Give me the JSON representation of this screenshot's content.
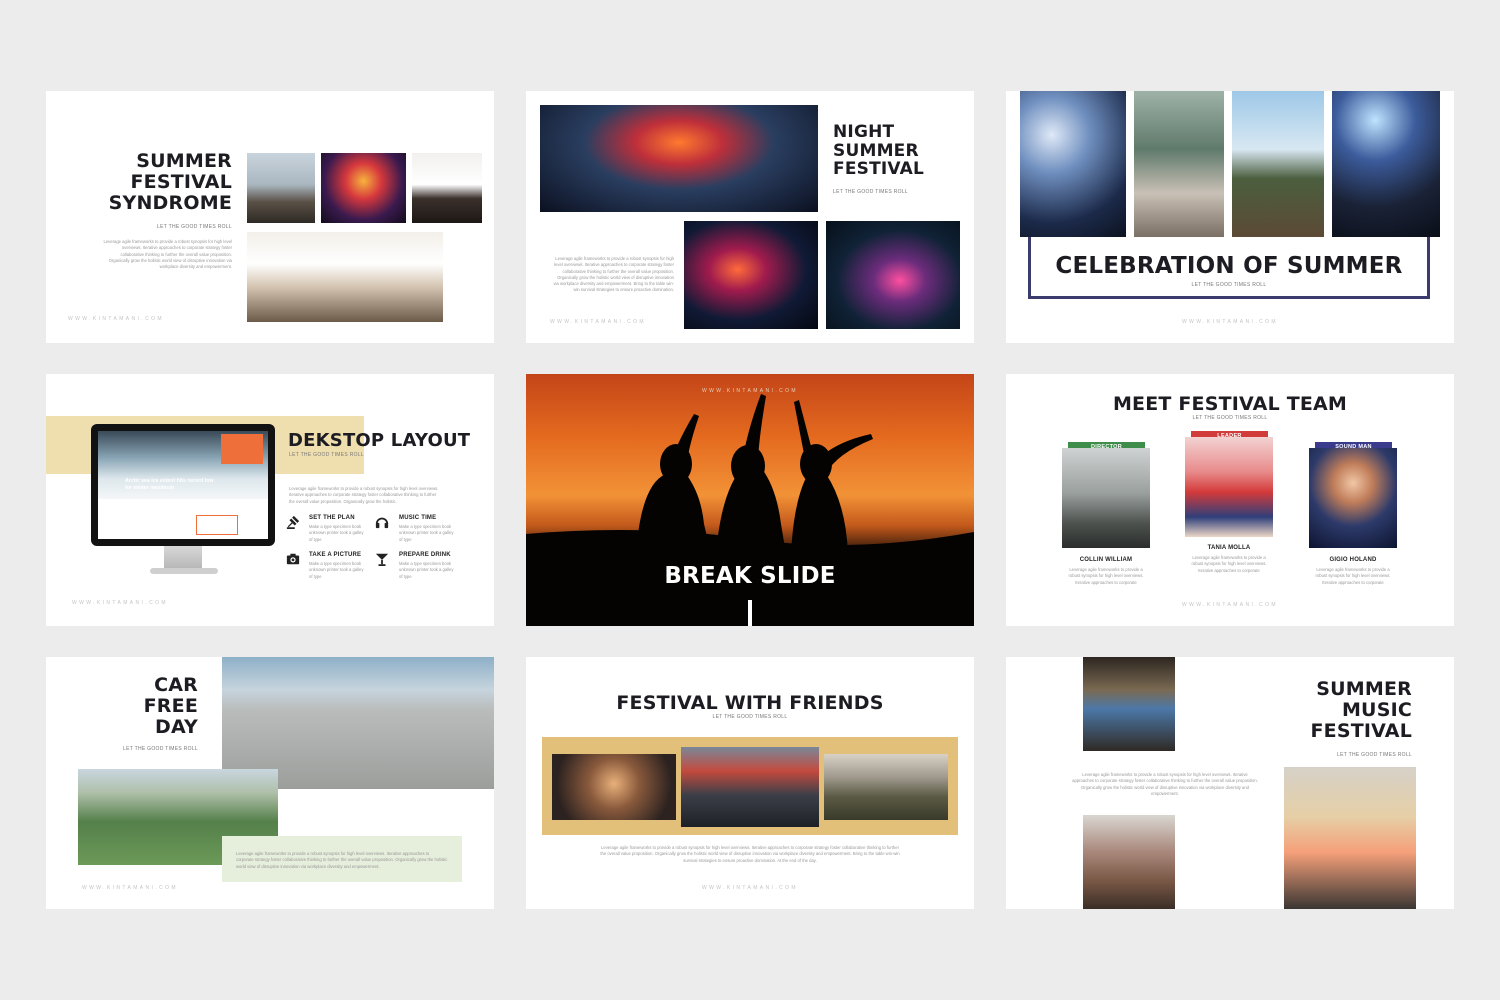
{
  "slides": {
    "s1": {
      "title_lines": [
        "SUMMER",
        "FESTIVAL",
        "SYNDROME"
      ],
      "tagline": "LET THE GOOD TIMES ROLL",
      "body": "Leverage agile frameworks to provide a robust synopsis for high level overviews. Iterative approaches to corporate strategy foster collaborative thinking to further the overall value proposition. Organically grow the holistic world view of disruptive innovation via workplace diversity and empowerment.",
      "footer": "WWW.KINTAMANI.COM"
    },
    "s2": {
      "title_lines": [
        "NIGHT",
        "SUMMER",
        "FESTIVAL"
      ],
      "tagline": "LET THE GOOD TIMES ROLL",
      "body": "Leverage agile frameworks to provide a robust synopsis for high level overviews. Iterative approaches to corporate strategy foster collaborative thinking to further the overall value proposition. Organically grow the holistic world view of disruptive innovation via workplace diversity and empowerment. Bring to the table win-win survival strategies to ensure proactive domination.",
      "footer": "WWW.KINTAMANI.COM"
    },
    "s3": {
      "title": "CELEBRATION OF SUMMER",
      "tagline": "LET THE GOOD TIMES ROLL",
      "footer": "WWW.KINTAMANI.COM",
      "frame_color": "#3b3b6e"
    },
    "s4": {
      "title": "DEKSTOP LAYOUT",
      "tagline": "LET THE GOOD TIMES ROLL",
      "body": "Leverage agile frameworks to provide a robust synopsis for high level overviews. Iterative approaches to corporate strategy foster collaborative thinking to further the overall value proposition. Organically grow the holistic.",
      "screen_headline": "Arctic sea ice extent hits record low for winter maximum",
      "features": [
        {
          "icon": "gavel-icon",
          "title": "SET THE PLAN",
          "text": "Make a type specimen book unknown printer took a galley of type"
        },
        {
          "icon": "headphones-icon",
          "title": "MUSIC TIME",
          "text": "Make a type specimen book unknown printer took a galley of type"
        },
        {
          "icon": "camera-icon",
          "title": "TAKE A PICTURE",
          "text": "Make a type specimen book unknown printer took a galley of type"
        },
        {
          "icon": "cocktail-icon",
          "title": "PREPARE DRINK",
          "text": "Make a type specimen book unknown printer took a galley of type"
        }
      ],
      "footer": "WWW.KINTAMANI.COM",
      "accent_color": "#f0dfae"
    },
    "s5": {
      "title": "BREAK SLIDE",
      "header": "WWW.KINTAMANI.COM"
    },
    "s6": {
      "title": "MEET FESTIVAL TEAM",
      "tagline": "LET THE GOOD TIMES ROLL",
      "members": [
        {
          "role": "DIRECTOR",
          "name": "COLLIN WILLIAM",
          "text": "Leverage agile frameworks to provide a robust synopsis for high level overviews. Iterative approaches to corporate",
          "role_color": "#3f8d4a"
        },
        {
          "role": "LEADER",
          "name": "TANIA MOLLA",
          "text": "Leverage agile frameworks to provide a robust synopsis for high level overviews. Iterative approaches to corporate",
          "role_color": "#d13b3b"
        },
        {
          "role": "SOUND MAN",
          "name": "GIGIO HOLAND",
          "text": "Leverage agile frameworks to provide a robust synopsis for high level overviews. Iterative approaches to corporate",
          "role_color": "#3b3b8e"
        }
      ],
      "footer": "WWW.KINTAMANI.COM"
    },
    "s7": {
      "title_lines": [
        "CAR",
        "FREE",
        "DAY"
      ],
      "tagline": "LET THE GOOD TIMES ROLL",
      "body": "Leverage agile frameworks to provide a robust synopsis for high level overviews. Iterative approaches to corporate strategy foster collaborative thinking to further the overall value proposition. Organically grow the holistic world view of disruptive innovation via workplace diversity and empowerment.",
      "footer": "WWW.KINTAMANI.COM",
      "box_color": "#e6eedc"
    },
    "s8": {
      "title": "FESTIVAL WITH FRIENDS",
      "tagline": "LET THE GOOD TIMES ROLL",
      "body": "Leverage agile frameworks to provide a robust synopsis for high level overviews. Iterative approaches to corporate strategy foster collaborative thinking to further the overall value proposition. Organically grow the holistic world view of disruptive innovation via workplace diversity and empowerment. Bring to the table win-win survival strategies to ensure proactive domination. At the end of the day.",
      "footer": "WWW.KINTAMANI.COM",
      "band_color": "#e2c07a"
    },
    "s9": {
      "title_lines": [
        "SUMMER",
        "MUSIC",
        "FESTIVAL"
      ],
      "tagline": "LET THE GOOD TIMES ROLL",
      "body": "Leverage agile frameworks to provide a robust synopsis for high level overviews. Iterative approaches to corporate strategy foster collaborative thinking to further the overall value proposition. Organically grow the holistic world view of disruptive innovation via workplace diversity and empowerment."
    }
  }
}
